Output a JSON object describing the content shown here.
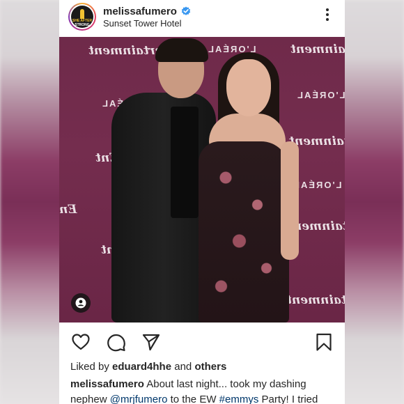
{
  "post": {
    "username": "melissafumero",
    "location": "Sunset Tower Hotel",
    "avatar_text_top": "SHE AFTER",
    "avatar_text_bottom": "STRONG",
    "verified_icon": "verified-badge-icon",
    "verified_color": "#3897f0"
  },
  "photo": {
    "wall_texts": [
      "Entertainment",
      "L'ORÉAL",
      "L'ORÉAL",
      "Entertainment",
      "L'ORÉAL",
      "Entertainment",
      "L'ORÉAL",
      "Entertainment",
      "Entertainment",
      "Ent",
      "Ent",
      "En"
    ]
  },
  "actions": {
    "like_icon": "heart-icon",
    "comment_icon": "comment-icon",
    "share_icon": "send-icon",
    "save_icon": "bookmark-icon",
    "tag_icon": "user-tag-icon"
  },
  "likes": {
    "prefix": "Liked by ",
    "user": "eduard4hhe",
    "middle": " and ",
    "others": "others"
  },
  "caption": {
    "author": "melissafumero",
    "text_1": " About last night... took my dashing nephew ",
    "mention": "@mrjfumero",
    "text_2": " to the EW ",
    "hashtag": "#emmys",
    "text_3": " Party! I tried"
  },
  "colors": {
    "background_wall": "#742d4e",
    "link": "#00376b",
    "text": "#262626"
  }
}
